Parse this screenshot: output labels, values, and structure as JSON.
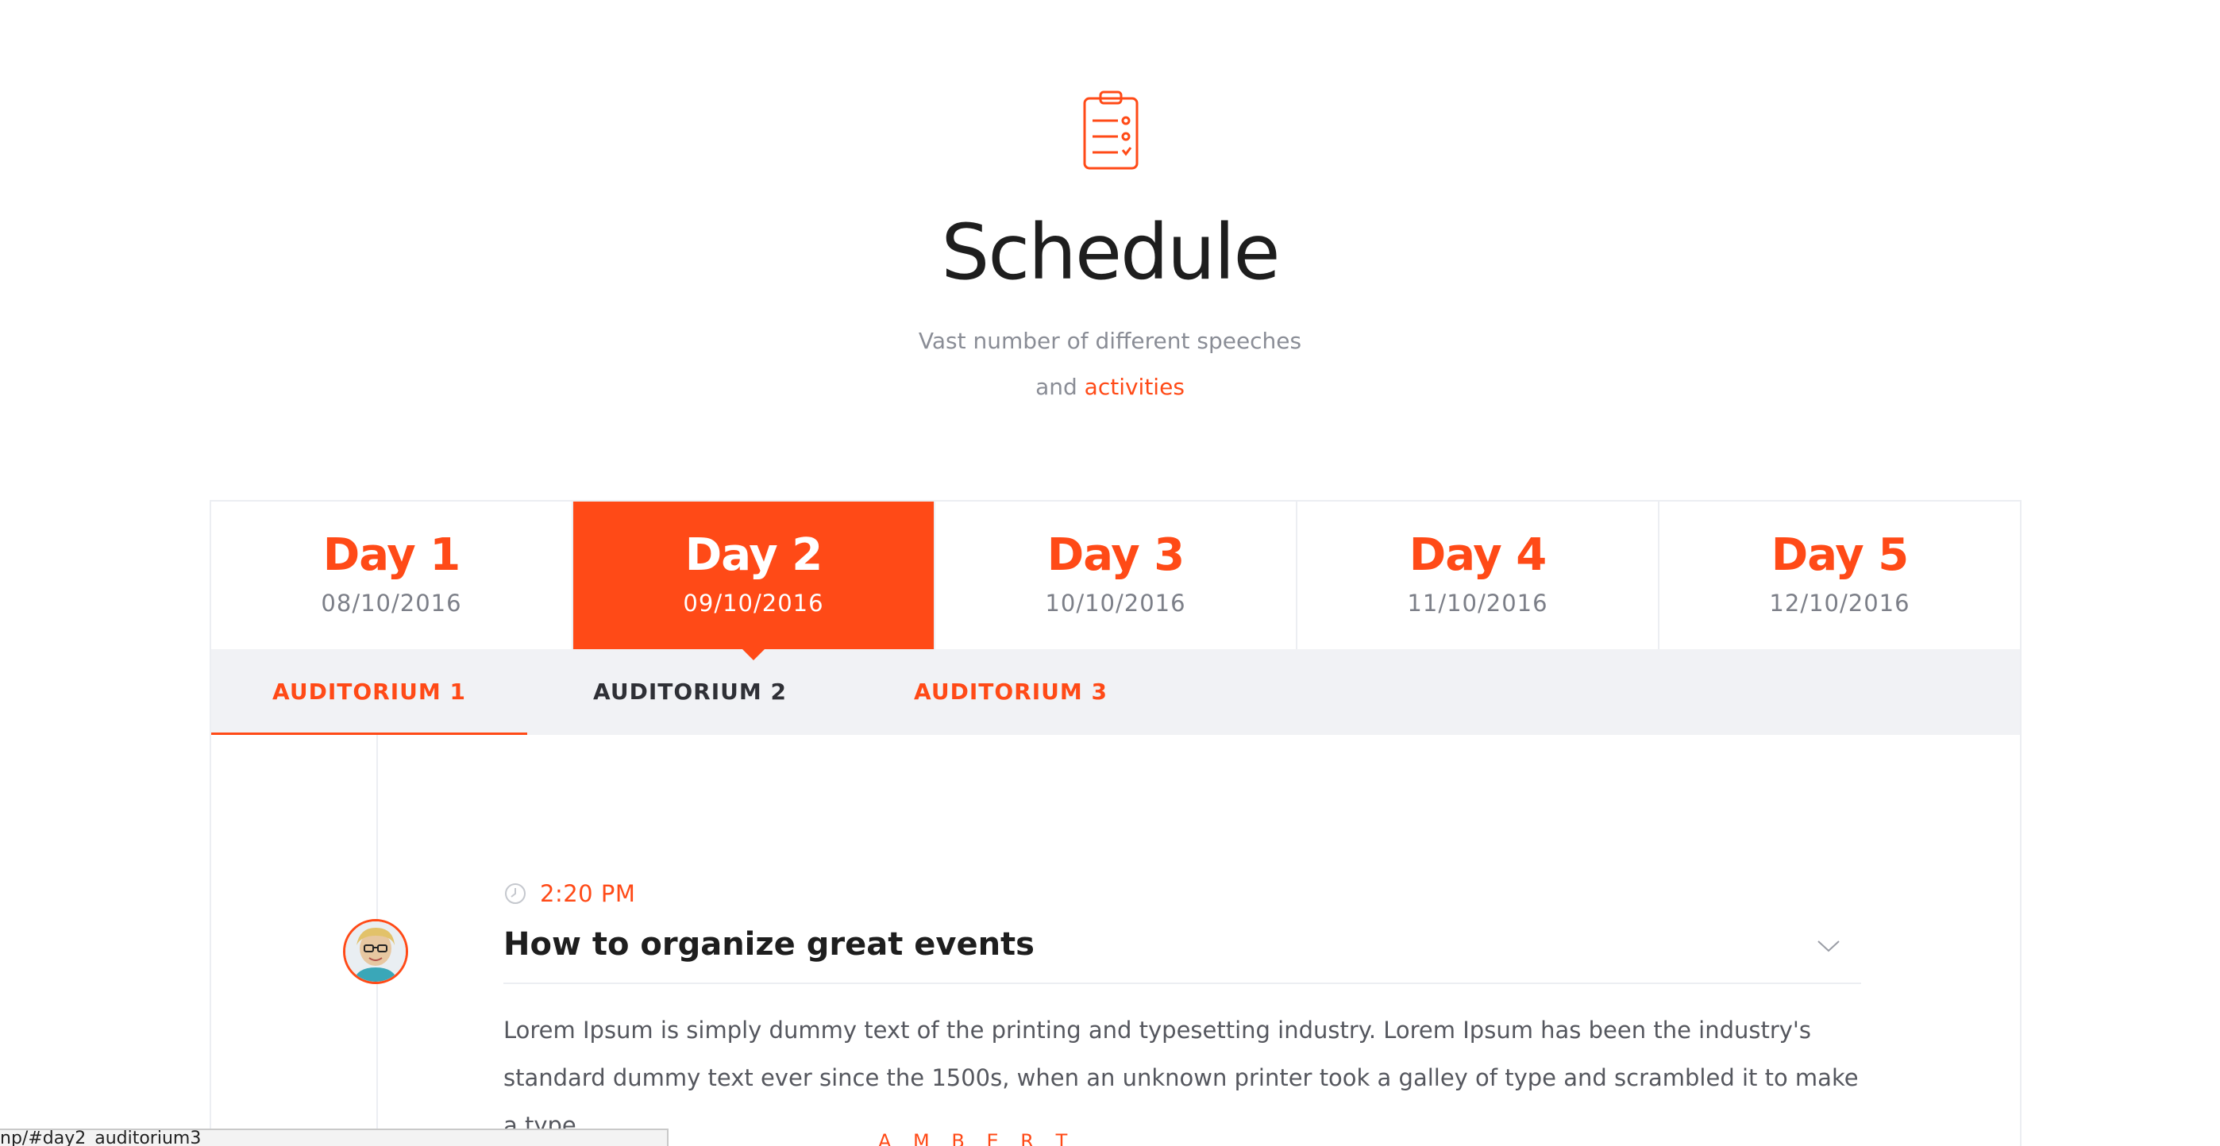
{
  "header": {
    "icon": "clipboard-checklist-icon",
    "title": "Schedule",
    "subtitle_line1": "Vast number of different speeches",
    "subtitle_line2_prefix": "and",
    "subtitle_line2_accent": "activities"
  },
  "colors": {
    "accent": "#ff4a17",
    "tab_bar_bg": "#f1f2f5",
    "text_dark": "#1e1e1e",
    "text_muted": "#8a8d96"
  },
  "days": [
    {
      "label": "Day 1",
      "date": "08/10/2016",
      "active": false
    },
    {
      "label": "Day 2",
      "date": "09/10/2016",
      "active": true
    },
    {
      "label": "Day 3",
      "date": "10/10/2016",
      "active": false
    },
    {
      "label": "Day 4",
      "date": "11/10/2016",
      "active": false
    },
    {
      "label": "Day 5",
      "date": "12/10/2016",
      "active": false
    }
  ],
  "auditoriums": [
    {
      "label": "AUDITORIUM 1",
      "active": true
    },
    {
      "label": "AUDITORIUM 2",
      "active": false
    },
    {
      "label": "AUDITORIUM 3",
      "active": false
    }
  ],
  "event": {
    "time": "2:20 PM",
    "title": "How to organize great events",
    "description": "Lorem Ipsum is simply dummy text of the printing and typesetting industry. Lorem Ipsum has been the industry's standard dummy text ever since the 1500s, when an unknown printer took a galley of type and scrambled it to make a type.",
    "speaker_partial": "A M B E R T"
  },
  "status_bar": {
    "url": "np/#day2_auditorium3"
  }
}
